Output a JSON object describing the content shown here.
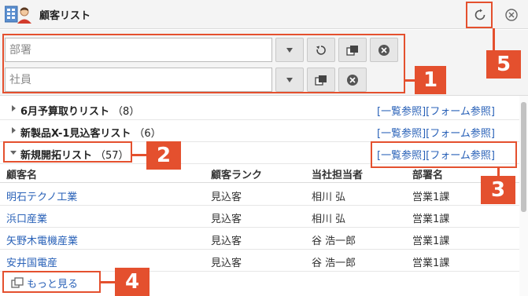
{
  "header": {
    "title": "顧客リスト"
  },
  "filters": {
    "department_placeholder": "部署",
    "employee_placeholder": "社員"
  },
  "groups": [
    {
      "name": "6月予算取りリスト",
      "count": "（8）",
      "list_link": "[一覧参照]",
      "form_link": "[フォーム参照]"
    },
    {
      "name": "新製品X-1見込客リスト",
      "count": "（6）",
      "list_link": "[一覧参照]",
      "form_link": "[フォーム参照]"
    },
    {
      "name": "新規開拓リスト",
      "count": "（57）",
      "list_link": "[一覧参照]",
      "form_link": "[フォーム参照]"
    }
  ],
  "table": {
    "columns": [
      "顧客名",
      "顧客ランク",
      "当社担当者",
      "部署名"
    ],
    "rows": [
      [
        "明石テクノ工業",
        "見込客",
        "相川 弘",
        "営業1課"
      ],
      [
        "浜口産業",
        "見込客",
        "相川 弘",
        "営業1課"
      ],
      [
        "矢野木電機産業",
        "見込客",
        "谷 浩一郎",
        "営業1課"
      ],
      [
        "安井国電産",
        "見込客",
        "谷 浩一郎",
        "営業1課"
      ]
    ]
  },
  "more_label": "もっと見る",
  "callouts": [
    "1",
    "2",
    "3",
    "4",
    "5"
  ],
  "colors": {
    "accent": "#e4502e",
    "link": "#2a62b8"
  }
}
